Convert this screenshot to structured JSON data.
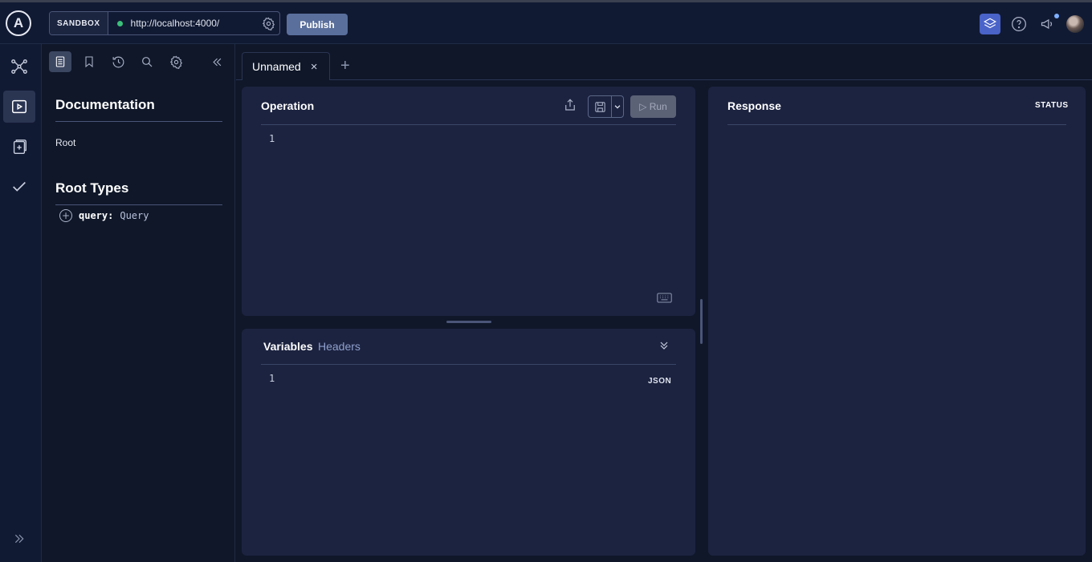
{
  "topbar": {
    "logo_letter": "A",
    "sandbox_label": "SANDBOX",
    "endpoint_url": "http://localhost:4000/",
    "publish_label": "Publish"
  },
  "rail": {
    "items": [
      {
        "icon": "graph-icon"
      },
      {
        "icon": "explorer-play-icon",
        "active": true
      },
      {
        "icon": "schema-icon"
      },
      {
        "icon": "checks-icon"
      }
    ],
    "expand_icon": "expand-chevrons-icon"
  },
  "docs": {
    "title": "Documentation",
    "breadcrumb_root": "Root",
    "root_types_title": "Root Types",
    "root_fields": [
      {
        "name": "query:",
        "type": "Query"
      }
    ]
  },
  "tabs": [
    {
      "label": "Unnamed",
      "close": "×"
    }
  ],
  "tab_add": "+",
  "operation": {
    "title": "Operation",
    "run_label": "▷ Run",
    "line_numbers": [
      "1"
    ]
  },
  "variables": {
    "title": "Variables",
    "headers_tab": "Headers",
    "line_numbers": [
      "1"
    ],
    "format_label": "JSON"
  },
  "response": {
    "title": "Response",
    "status_label": "STATUS"
  },
  "colors": {
    "background": "#0f1729",
    "panel": "#1c2340",
    "accent": "#4a63c8",
    "publish": "#5a6f9c",
    "status_dot": "#3ac07a"
  }
}
